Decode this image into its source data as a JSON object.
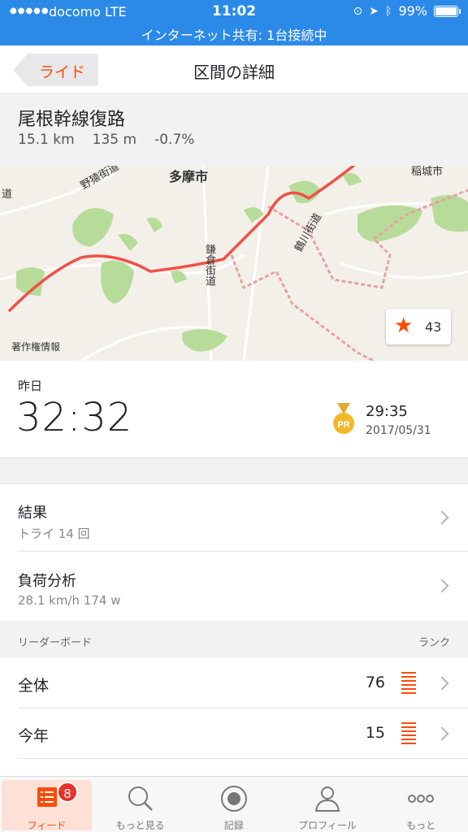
{
  "status_bar": {
    "signal_dots": "●●●●●",
    "carrier": "docomo  LTE",
    "time": "11:02",
    "battery": "99%",
    "hotspot": "インターネット共有: 1台接続中"
  },
  "nav": {
    "back_label": "ライド",
    "title": "区間の詳細"
  },
  "segment": {
    "name": "尾根幹線復路",
    "distance": "15.1 km",
    "elevation": "135 m",
    "grade": "-0.7%"
  },
  "map": {
    "labels": {
      "city1": "多摩市",
      "city2": "稲城市",
      "road1": "野猿街道",
      "road2": "鎌倉街道",
      "road3": "鶴川街道",
      "copyright": "著作権情報",
      "edge_left": "道"
    },
    "star_count": "43"
  },
  "effort": {
    "date_label": "昨日",
    "time": "32:32",
    "pr_time": "29:35",
    "pr_date": "2017/05/31",
    "pr_badge": "PR"
  },
  "rows": {
    "results": {
      "title": "結果",
      "subtitle": "トライ 14 回"
    },
    "analysis": {
      "title": "負荷分析",
      "subtitle": "28.1 km/h 174 w"
    }
  },
  "leaderboard": {
    "header_left": "リーダーボード",
    "header_right": "ランク",
    "rows": [
      {
        "label": "全体",
        "value": "76"
      },
      {
        "label": "今年",
        "value": "15"
      }
    ]
  },
  "tabs": [
    {
      "label": "フィード",
      "icon": "feed-icon",
      "badge": "8"
    },
    {
      "label": "もっと見る",
      "icon": "search-icon"
    },
    {
      "label": "記録",
      "icon": "record-icon"
    },
    {
      "label": "プロフィール",
      "icon": "profile-icon"
    },
    {
      "label": "もっと",
      "icon": "more-icon"
    }
  ],
  "colors": {
    "accent": "#fc4c02",
    "status_bar": "#2b8ae8",
    "route": "#f0504a"
  }
}
